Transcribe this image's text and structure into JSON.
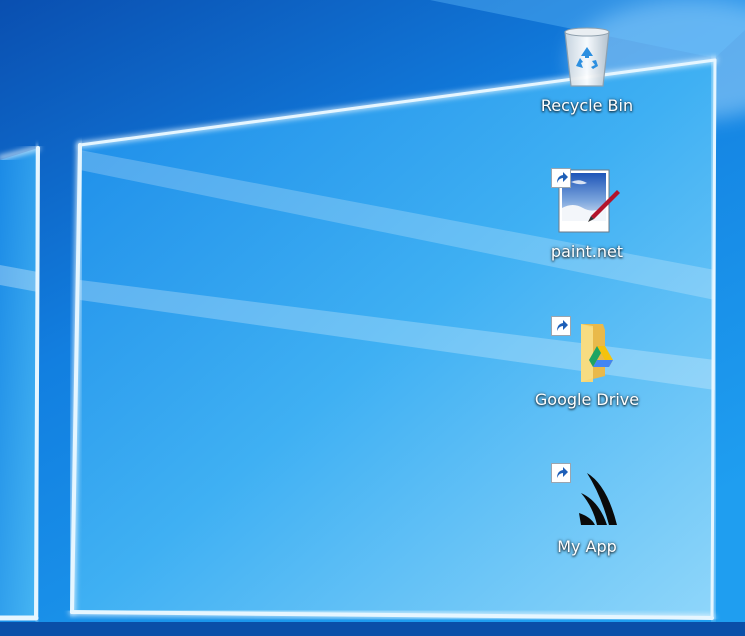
{
  "desktop": {
    "colors": {
      "wallpaper_top": "#0a5fc4",
      "wallpaper_mid": "#1a8fe8",
      "wallpaper_bottom": "#5ec0f5",
      "light_beam": "#e6f6ff"
    },
    "icons": [
      {
        "id": "recycle-bin",
        "label": "Recycle Bin",
        "icon": "recycle-bin-icon",
        "shortcut": false
      },
      {
        "id": "paint-net",
        "label": "paint.net",
        "icon": "paint-net-icon",
        "shortcut": true
      },
      {
        "id": "google-drive",
        "label": "Google Drive",
        "icon": "google-drive-folder-icon",
        "shortcut": true
      },
      {
        "id": "my-app",
        "label": "My App",
        "icon": "shark-fin-icon",
        "shortcut": true
      }
    ]
  }
}
